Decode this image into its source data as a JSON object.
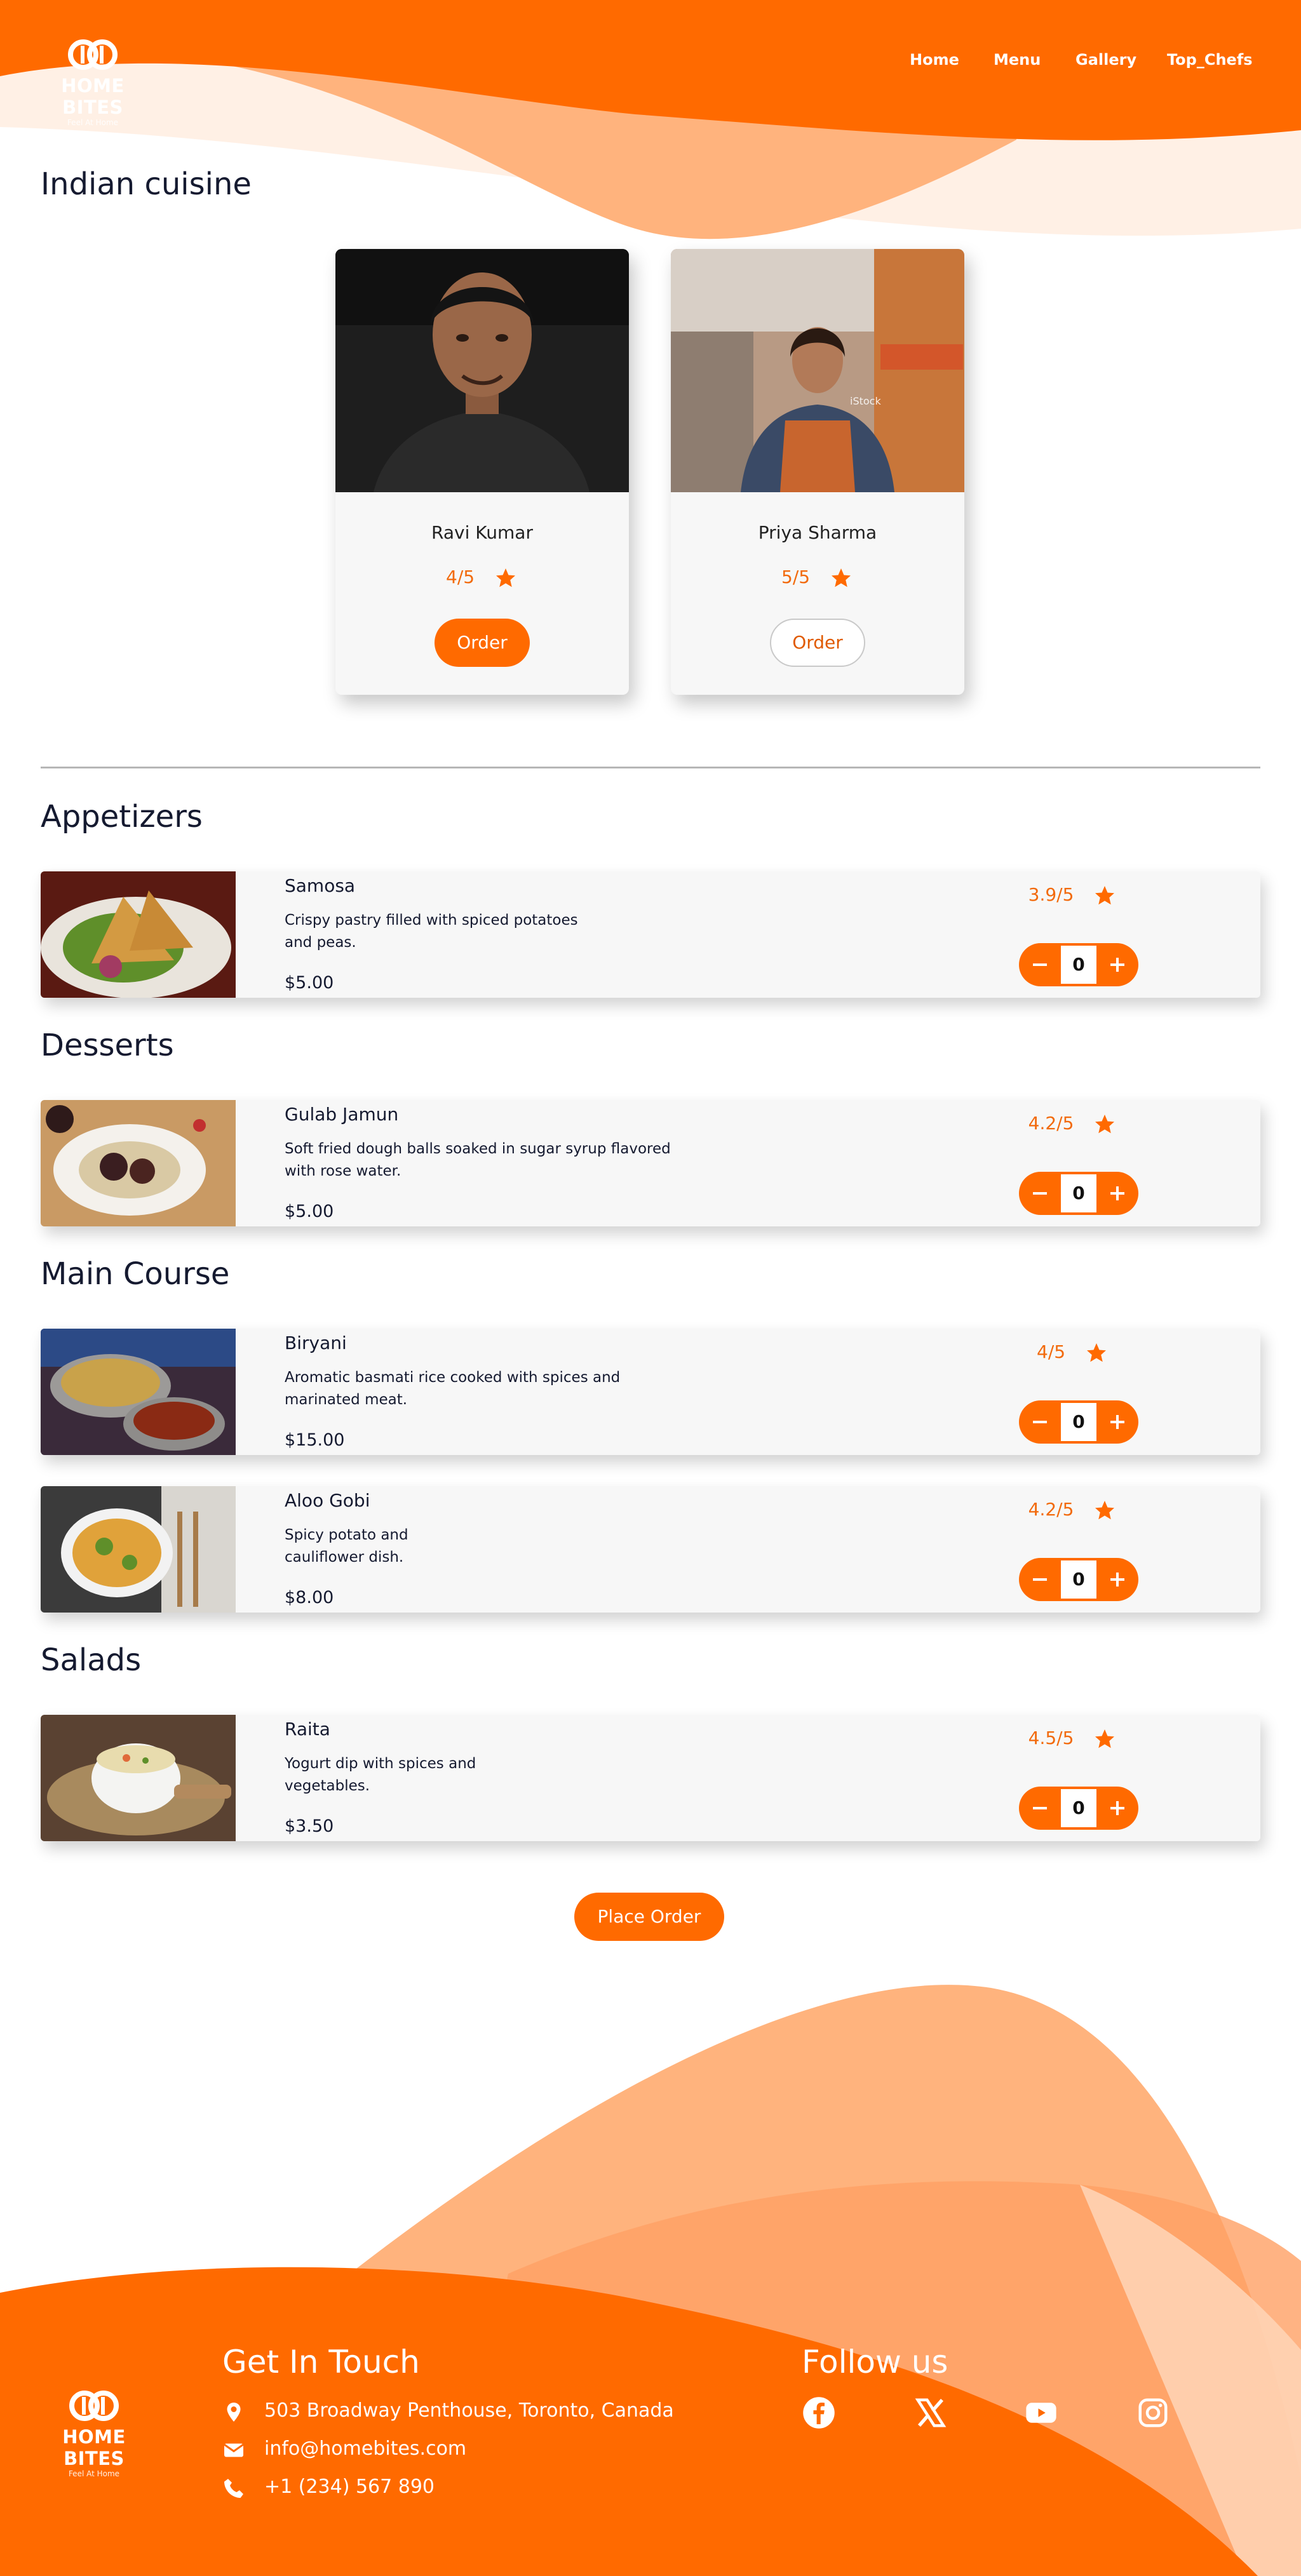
{
  "brand": {
    "name": "HOME BITES",
    "tagline": "Feel At Home",
    "colors": {
      "primary": "#ff6a00",
      "accent_text": "#f26a0c",
      "heading": "#151a30"
    }
  },
  "nav": {
    "items": [
      "Home",
      "Menu",
      "Gallery",
      "Top_Chefs"
    ]
  },
  "cuisine": {
    "title": "Indian cuisine"
  },
  "chefs": [
    {
      "name": "Ravi Kumar",
      "rating": "4/5",
      "order_label": "Order",
      "button_style": "filled"
    },
    {
      "name": "Priya Sharma",
      "rating": "5/5",
      "order_label": "Order",
      "button_style": "outline"
    }
  ],
  "menu": {
    "sections": [
      {
        "title": "Appetizers",
        "items": [
          {
            "name": "Samosa",
            "desc_line1": "Crispy pastry filled with spiced potatoes",
            "desc_line2": "and peas.",
            "price": "$5.00",
            "rating": "3.9/5",
            "qty": "0"
          }
        ]
      },
      {
        "title": "Desserts",
        "items": [
          {
            "name": "Gulab Jamun",
            "desc_line1": "Soft fried dough balls soaked in sugar syrup flavored",
            "desc_line2": "with rose water.",
            "price": "$5.00",
            "rating": "4.2/5",
            "qty": "0"
          }
        ]
      },
      {
        "title": "Main Course",
        "items": [
          {
            "name": "Biryani",
            "desc_line1": "Aromatic basmati rice cooked with spices and",
            "desc_line2": "marinated meat.",
            "price": "$15.00",
            "rating": "4/5",
            "qty": "0"
          },
          {
            "name": "Aloo Gobi",
            "desc_line1": "Spicy potato and",
            "desc_line2": "cauliflower dish.",
            "price": "$8.00",
            "rating": "4.2/5",
            "qty": "0"
          }
        ]
      },
      {
        "title": "Salads",
        "items": [
          {
            "name": "Raita",
            "desc_line1": "Yogurt dip with spices and",
            "desc_line2": "vegetables.",
            "price": "$3.50",
            "rating": "4.5/5",
            "qty": "0"
          }
        ]
      }
    ],
    "minus_icon": "minus-icon",
    "plus_icon": "plus-icon"
  },
  "place_order_label": "Place Order",
  "footer": {
    "contact_title": "Get In Touch",
    "address": "503 Broadway Penthouse, Toronto, Canada",
    "email": "info@homebites.com",
    "phone": "+1 (234) 567 890",
    "follow_title": "Follow us",
    "socials": [
      "facebook-icon",
      "x-icon",
      "youtube-icon",
      "instagram-icon"
    ]
  }
}
